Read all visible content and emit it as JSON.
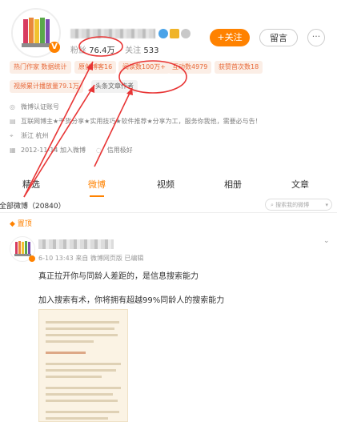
{
  "header": {
    "avatar_label": "avatar",
    "fans_label": "粉丝",
    "fans_count": "76.4万",
    "following_label": "关注",
    "following_count": "533",
    "follow_button": "+关注",
    "message_button": "留言",
    "more_button": "···"
  },
  "tags": [
    "热门作家 数据统计",
    "原创博客16",
    "阅读数100万+",
    "互动数4979",
    "获赞首次数18",
    "视频累计播放量79.1万",
    "头条文章作者"
  ],
  "info": {
    "verified": "微博认证账号",
    "intro": "互联网博主★干货分享★实用技巧★软件推荐★分享为工，服务你我他，需要必与告！",
    "location": "浙江 杭州",
    "joined": "2012-11-14 加入微博",
    "credit": "信用极好"
  },
  "tabs": [
    "精选",
    "微博",
    "视频",
    "相册",
    "文章"
  ],
  "active_tab": "微博",
  "feed": {
    "all_posts_label": "全部微博（20840）",
    "search_placeholder": "搜索我的微博",
    "pinned_label": "置顶",
    "post_meta": "6-10 13:43 来自 微博网页版 已编辑",
    "post_line1": "真正拉开你与同龄人差距的，是信息搜索能力",
    "post_line2": "加入搜索有术，你将拥有超越99%同龄人的搜索能力"
  },
  "colors": {
    "accent": "#ff8200",
    "annotation": "#e83535",
    "tag_bg": "#fbeee6",
    "tag_text": "#e86a3a"
  }
}
